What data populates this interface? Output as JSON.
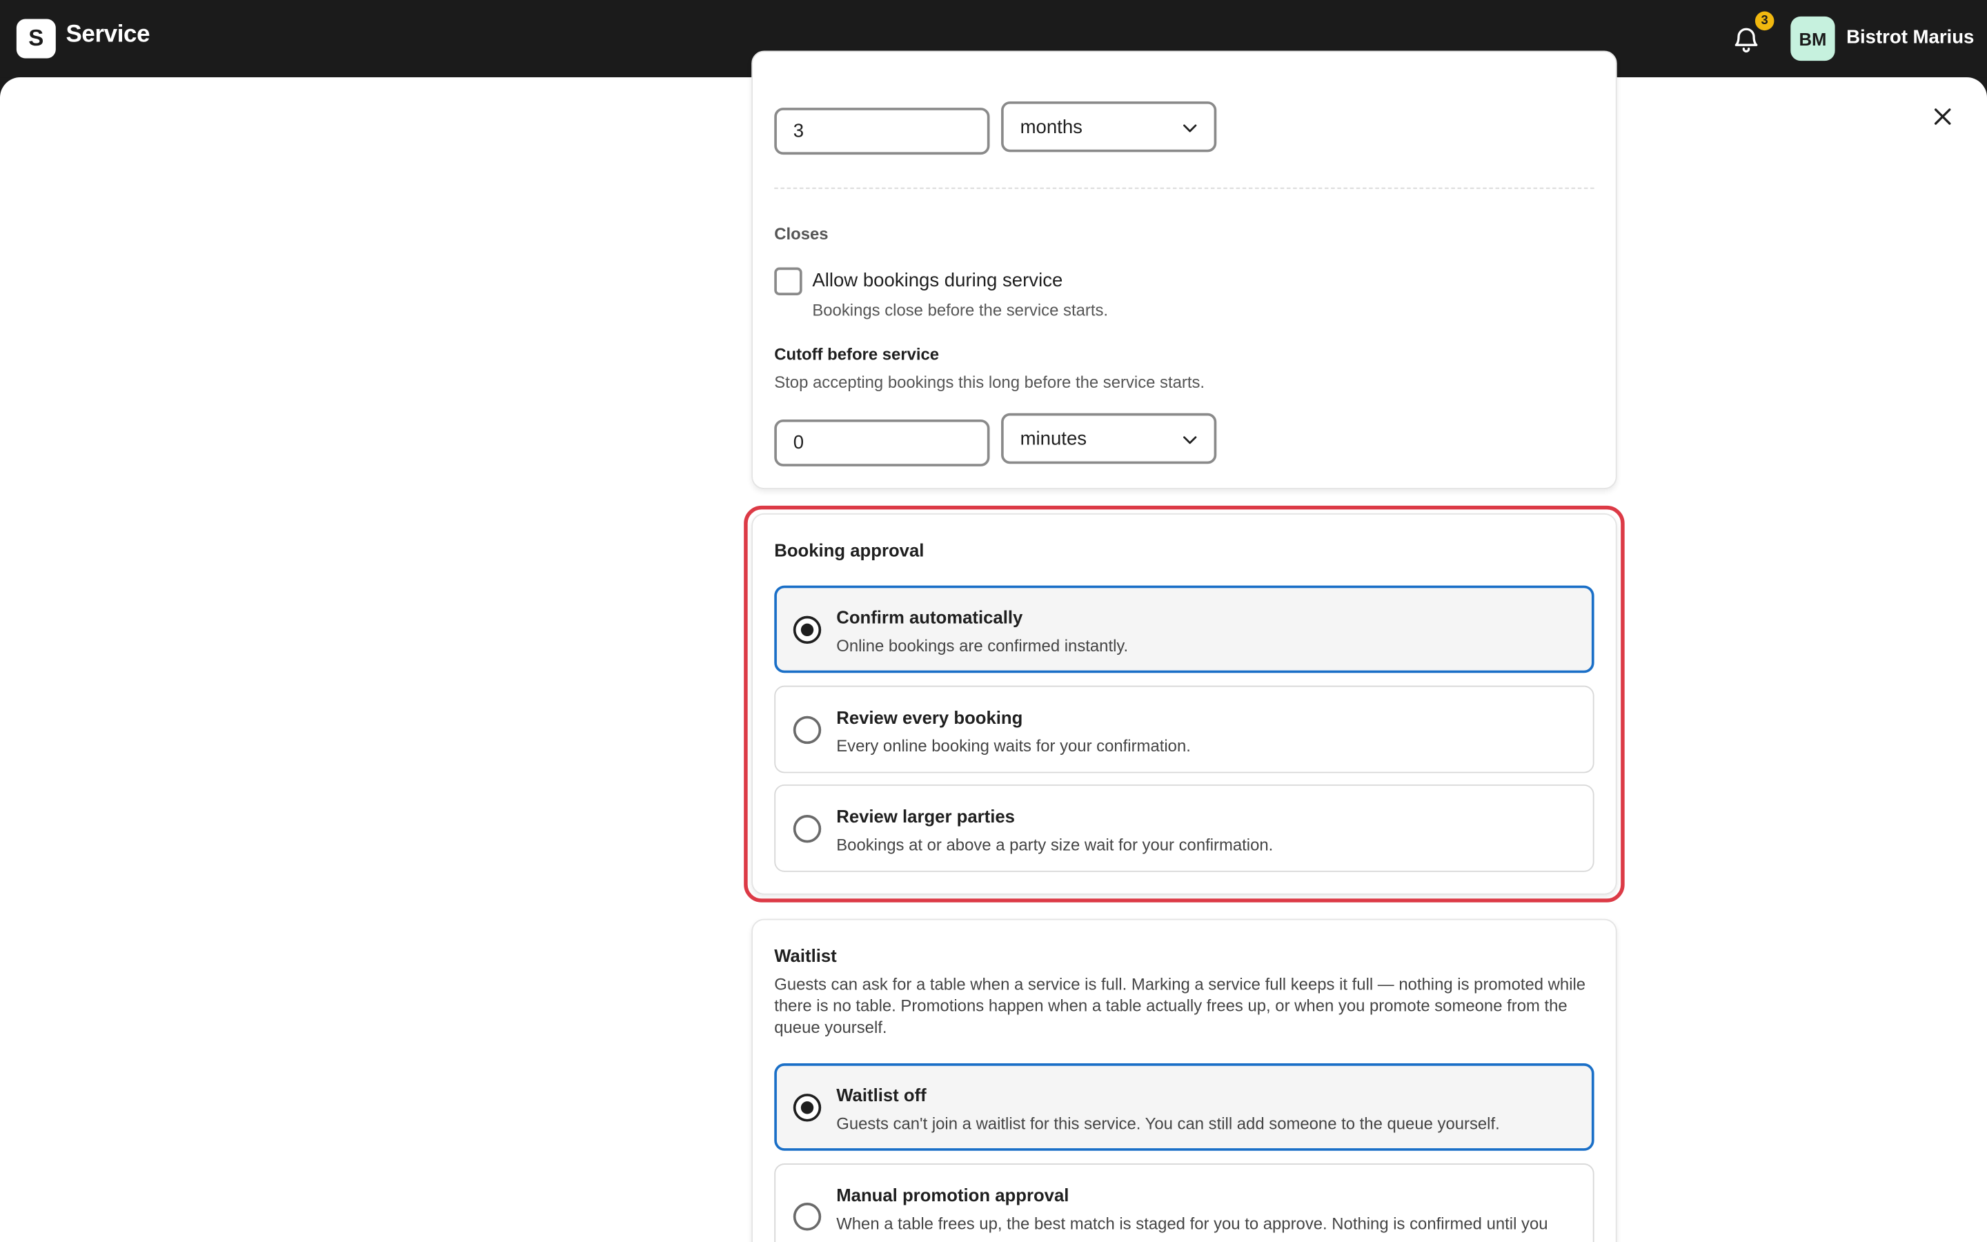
{
  "app": {
    "logo_letter": "S",
    "title": "Service"
  },
  "header": {
    "notification_count": "3",
    "avatar_initials": "BM",
    "org_name": "Bistrot Marius"
  },
  "advance": {
    "value": "3",
    "unit": "months"
  },
  "closes": {
    "heading": "Closes",
    "allow_label": "Allow bookings during service",
    "allow_checked": false,
    "allow_hint": "Bookings close before the service starts.",
    "cutoff_title": "Cutoff before service",
    "cutoff_desc": "Stop accepting bookings this long before the service starts.",
    "cutoff_value": "0",
    "cutoff_unit": "minutes"
  },
  "approval": {
    "title": "Booking approval",
    "options": [
      {
        "title": "Confirm automatically",
        "desc": "Online bookings are confirmed instantly.",
        "selected": true
      },
      {
        "title": "Review every booking",
        "desc": "Every online booking waits for your confirmation.",
        "selected": false
      },
      {
        "title": "Review larger parties",
        "desc": "Bookings at or above a party size wait for your confirmation.",
        "selected": false
      }
    ]
  },
  "waitlist": {
    "title": "Waitlist",
    "desc": "Guests can ask for a table when a service is full. Marking a service full keeps it full — nothing is promoted while there is no table. Promotions happen when a table actually frees up, or when you promote someone from the queue yourself.",
    "options": [
      {
        "title": "Waitlist off",
        "desc": "Guests can't join a waitlist for this service. You can still add someone to the queue yourself.",
        "selected": true
      },
      {
        "title": "Manual promotion approval",
        "desc": "When a table frees up, the best match is staged for you to approve. Nothing is confirmed until you",
        "selected": false
      }
    ]
  },
  "colors": {
    "topbar": "#1b1b1b",
    "accent": "#1a6fc7",
    "highlight": "#dc3a46",
    "badge": "#f1b80f",
    "avatar": "#c6f1de"
  }
}
